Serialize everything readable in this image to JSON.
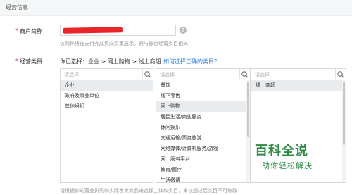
{
  "section": {
    "title": "经营信息"
  },
  "merchant_name": {
    "required_mark": "*",
    "label": "商户简称",
    "help_icon": "question-circle-icon",
    "help_glyph": "?",
    "hint": "该简称将在支付完成页向买家展示，需与微信经营类目相关"
  },
  "category": {
    "required_mark": "*",
    "label": "经营类目",
    "selected_path": "你已选择：企业 > 网上购物 > 线上商超",
    "help_link": "如何选择正确的类目？",
    "bottom_note": "请根据你的营业执照和实际售卖商品来选择主体和类目，审核通过后类目不可修改",
    "search_icon": "magnifier-icon",
    "panels": [
      {
        "placeholder": "请选择",
        "items": [
          {
            "label": "企业",
            "selected": true
          },
          {
            "label": "政府及事业单位",
            "selected": false
          },
          {
            "label": "其他组织",
            "selected": false
          }
        ]
      },
      {
        "placeholder": "请选择",
        "items": [
          {
            "label": "餐饮",
            "selected": false
          },
          {
            "label": "线下零售",
            "selected": false
          },
          {
            "label": "网上购物",
            "selected": true
          },
          {
            "label": "居民生活/商业服务",
            "selected": false
          },
          {
            "label": "休闲娱乐",
            "selected": false
          },
          {
            "label": "交通运输/票务旅游",
            "selected": false
          },
          {
            "label": "网络媒体/计算机服务/游戏",
            "selected": false
          },
          {
            "label": "网上服务平台",
            "selected": false
          },
          {
            "label": "教育/医疗",
            "selected": false
          },
          {
            "label": "生活缴费",
            "selected": false
          }
        ]
      },
      {
        "placeholder": "请选择",
        "items": [
          {
            "label": "线上商超",
            "selected": true
          }
        ]
      }
    ]
  },
  "watermark": {
    "title": "百科全说",
    "subtitle": "助你轻松解决"
  },
  "colors": {
    "link": "#2a7ae2",
    "required": "#e0403e",
    "redaction": "#e8262a",
    "selected_bg": "#e9ecef",
    "watermark": "#2d8a43"
  }
}
